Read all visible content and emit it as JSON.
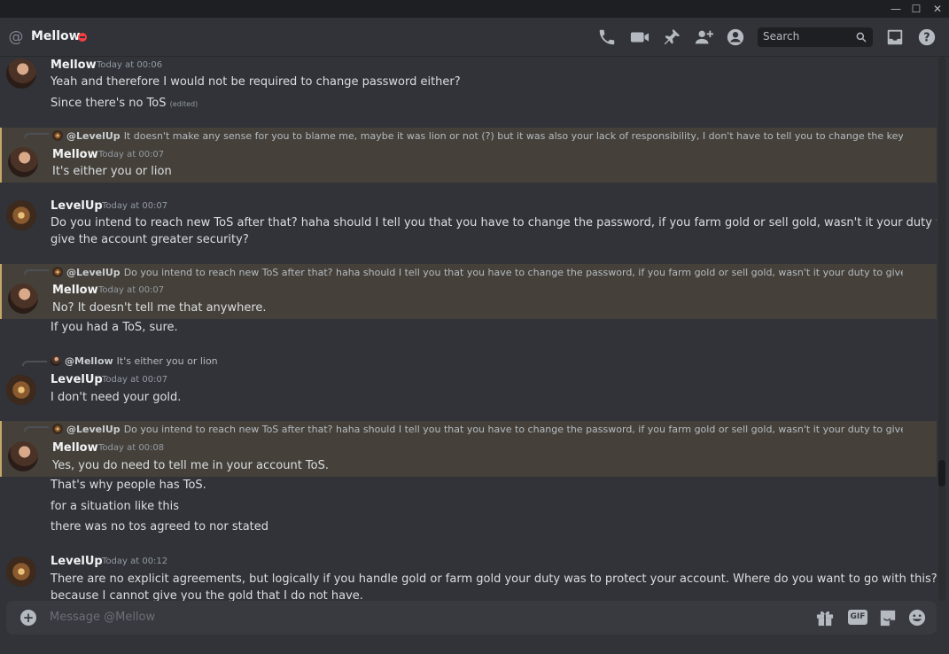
{
  "window": {
    "minimize": "—",
    "maximize": "☐",
    "close": "✕"
  },
  "header": {
    "channel": "Mellow",
    "search_placeholder": "Search"
  },
  "messages": [
    {
      "author": "Mellow",
      "time": "Today at 00:06",
      "lines": [
        "Yeah and therefore I would not be required to change password either?",
        "Since there's no ToS"
      ],
      "edited": "(edited)"
    },
    {
      "reply_user": "@LevelUp",
      "reply_text": "It doesn't make any sense for you to blame me, maybe it was lion or not (?) but it was also your lack of responsibility, I don't have to tell you to change the key that you",
      "author": "Mellow",
      "time": "Today at 00:07",
      "lines": [
        "It's either you or lion"
      ]
    },
    {
      "author": "LevelUp",
      "time": "Today at 00:07",
      "lines": [
        "Do you intend to reach new ToS after that? haha should I tell you that you have to change the password, if you farm gold or sell gold, wasn't it your duty to",
        "give the account greater security?"
      ]
    },
    {
      "reply_user": "@LevelUp",
      "reply_text": "Do you intend to reach new ToS after that? haha should I tell you that you have to change the password, if you farm gold or sell gold, wasn't it your duty to give the acc",
      "author": "Mellow",
      "time": "Today at 00:07",
      "lines": [
        "No? It doesn't tell me that anywhere.",
        "If you had a ToS, sure."
      ]
    },
    {
      "reply_user": "@Mellow",
      "reply_text": "It's either you or lion",
      "author": "LevelUp",
      "time": "Today at 00:07",
      "lines": [
        "I don't need your gold."
      ]
    },
    {
      "reply_user": "@LevelUp",
      "reply_text": "Do you intend to reach new ToS after that? haha should I tell you that you have to change the password, if you farm gold or sell gold, wasn't it your duty to give the acc",
      "author": "Mellow",
      "time": "Today at 00:08",
      "lines": [
        "Yes, you do need to tell me in your account ToS.",
        "That's why people has ToS.",
        "for a situation like this",
        "there was no tos agreed to nor stated"
      ]
    },
    {
      "author": "LevelUp",
      "time": "Today at 00:12",
      "lines": [
        "There are no explicit agreements, but logically if you handle gold or farm gold your duty was to protect your account. Where do you want to go with this?",
        "because I cannot give you the gold that I do not have."
      ]
    }
  ],
  "composer": {
    "placeholder": "Message @Mellow",
    "plus": "+",
    "gif": "GIF"
  },
  "colors": {
    "highlight_bg": "#45413a",
    "highlight_border": "#c6a76a",
    "dnd": "#f23f43"
  },
  "icons": [
    "at-icon",
    "call-icon",
    "video-icon",
    "pin-icon",
    "add-friend-icon",
    "profile-icon",
    "search-icon",
    "inbox-icon",
    "help-icon",
    "gift-icon",
    "sticker-icon",
    "emoji-icon"
  ]
}
